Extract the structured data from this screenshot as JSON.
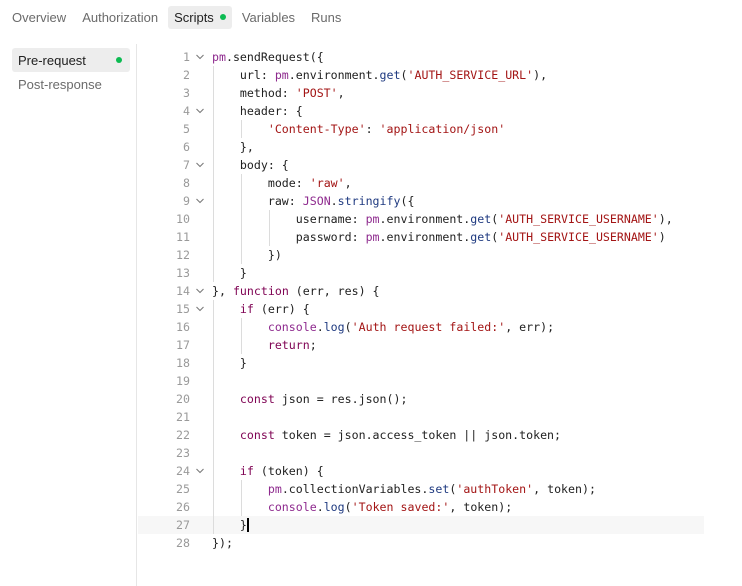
{
  "tabs": [
    {
      "label": "Overview"
    },
    {
      "label": "Authorization"
    },
    {
      "label": "Scripts",
      "active": true,
      "has_indicator": true
    },
    {
      "label": "Variables"
    },
    {
      "label": "Runs"
    }
  ],
  "script_phases": [
    {
      "label": "Pre-request",
      "active": true,
      "has_indicator": true
    },
    {
      "label": "Post-response"
    }
  ],
  "colors": {
    "indicator": "#0cbb52",
    "keyword": "#800555",
    "string": "#a31515",
    "object": "#8e2a8e"
  },
  "editor": {
    "current_line": 27,
    "lines": [
      {
        "n": "1",
        "fold": true,
        "text": "pm.sendRequest({"
      },
      {
        "n": "2",
        "fold": false,
        "text": "    url: pm.environment.get('AUTH_SERVICE_URL'),"
      },
      {
        "n": "3",
        "fold": false,
        "text": "    method: 'POST',"
      },
      {
        "n": "4",
        "fold": true,
        "text": "    header: {"
      },
      {
        "n": "5",
        "fold": false,
        "text": "        'Content-Type': 'application/json'"
      },
      {
        "n": "6",
        "fold": false,
        "text": "    },"
      },
      {
        "n": "7",
        "fold": true,
        "text": "    body: {"
      },
      {
        "n": "8",
        "fold": false,
        "text": "        mode: 'raw',"
      },
      {
        "n": "9",
        "fold": true,
        "text": "        raw: JSON.stringify({"
      },
      {
        "n": "10",
        "fold": false,
        "text": "            username: pm.environment.get('AUTH_SERVICE_USERNAME'),"
      },
      {
        "n": "11",
        "fold": false,
        "text": "            password: pm.environment.get('AUTH_SERVICE_USERNAME')"
      },
      {
        "n": "12",
        "fold": false,
        "text": "        })"
      },
      {
        "n": "13",
        "fold": false,
        "text": "    }"
      },
      {
        "n": "14",
        "fold": true,
        "text": "}, function (err, res) {"
      },
      {
        "n": "15",
        "fold": true,
        "text": "    if (err) {"
      },
      {
        "n": "16",
        "fold": false,
        "text": "        console.log('Auth request failed:', err);"
      },
      {
        "n": "17",
        "fold": false,
        "text": "        return;"
      },
      {
        "n": "18",
        "fold": false,
        "text": "    }"
      },
      {
        "n": "19",
        "fold": false,
        "text": ""
      },
      {
        "n": "20",
        "fold": false,
        "text": "    const json = res.json();"
      },
      {
        "n": "21",
        "fold": false,
        "text": ""
      },
      {
        "n": "22",
        "fold": false,
        "text": "    const token = json.access_token || json.token;"
      },
      {
        "n": "23",
        "fold": false,
        "text": ""
      },
      {
        "n": "24",
        "fold": true,
        "text": "    if (token) {"
      },
      {
        "n": "25",
        "fold": false,
        "text": "        pm.collectionVariables.set('authToken', token);"
      },
      {
        "n": "26",
        "fold": false,
        "text": "        console.log('Token saved:', token);"
      },
      {
        "n": "27",
        "fold": false,
        "text": "    }"
      },
      {
        "n": "28",
        "fold": false,
        "text": "});"
      }
    ]
  }
}
